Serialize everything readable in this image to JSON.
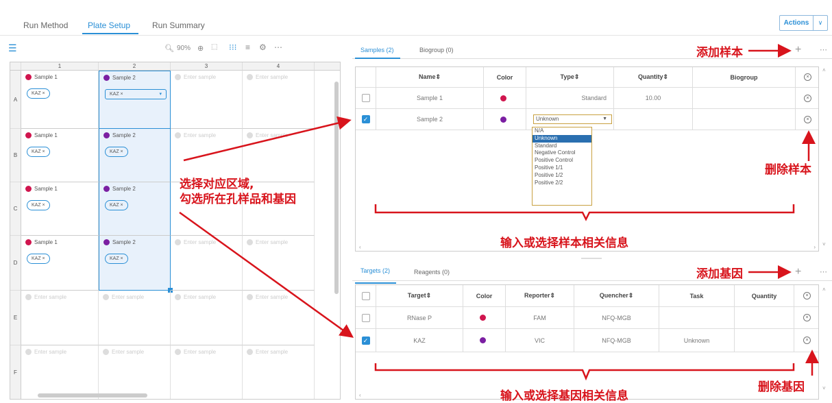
{
  "top_tabs": [
    "Run Method",
    "Plate Setup",
    "Run Summary"
  ],
  "actions": {
    "label": "Actions"
  },
  "plate_toolbar": {
    "zoom": "90%"
  },
  "plate": {
    "columns": [
      "1",
      "2",
      "3",
      "4"
    ],
    "rows": [
      "A",
      "B",
      "C",
      "D",
      "E",
      "F"
    ],
    "sample1": "Sample 1",
    "sample2": "Sample 2",
    "enter": "Enter sample",
    "tag": "KAZ ×"
  },
  "samples_panel": {
    "tabs": [
      "Samples (2)",
      "Biogroup (0)"
    ],
    "headers": [
      "Name⇕",
      "Color",
      "Type⇕",
      "Quantity⇕",
      "Biogroup"
    ],
    "rows": [
      {
        "name": "Sample 1",
        "color": "#d0154e",
        "type": "Standard",
        "quantity": "10.00",
        "checked": false
      },
      {
        "name": "Sample 2",
        "color": "#7b1fa2",
        "type": "Unknown",
        "quantity": "",
        "checked": true
      }
    ],
    "type_options": [
      "N/A",
      "Unknown",
      "Standard",
      "Negative Control",
      "Positive Control",
      "Positive 1/1",
      "Positive 1/2",
      "Positive 2/2"
    ]
  },
  "targets_panel": {
    "tabs": [
      "Targets (2)",
      "Reagents (0)"
    ],
    "headers": [
      "Target⇕",
      "Color",
      "Reporter⇕",
      "Quencher⇕",
      "Task",
      "Quantity"
    ],
    "rows": [
      {
        "target": "RNase P",
        "color": "#d0154e",
        "reporter": "FAM",
        "quencher": "NFQ-MGB",
        "task": "",
        "checked": false
      },
      {
        "target": "KAZ",
        "color": "#7b1fa2",
        "reporter": "VIC",
        "quencher": "NFQ-MGB",
        "task": "Unknown",
        "checked": true
      }
    ]
  },
  "annotations": {
    "add_sample": "添加样本",
    "delete_sample": "删除样本",
    "select_line1": "选择对应区域,",
    "select_line2": "勾选所在孔样品和基因",
    "input_sample": "输入或选择样本相关信息",
    "add_gene": "添加基因",
    "delete_gene": "删除基因",
    "input_gene": "输入或选择基因相关信息"
  },
  "colors": {
    "accent": "#2a8fd6",
    "annotation": "#d8141c"
  }
}
